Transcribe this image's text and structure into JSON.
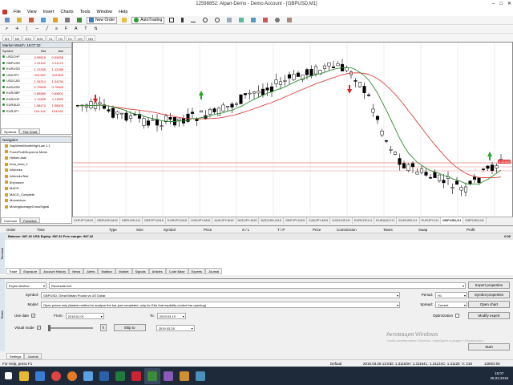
{
  "window": {
    "title": "12598852: Alpari-Demo - Demo Account - [GBPUSD,M1]",
    "minimize": "–",
    "maximize": "□",
    "close": "✕"
  },
  "menu": [
    "File",
    "View",
    "Insert",
    "Charts",
    "Tools",
    "Window",
    "Help"
  ],
  "toolbar": {
    "new_order": "New Order",
    "autotrading": "AutoTrading"
  },
  "timeframes": [
    "M1",
    "M5",
    "M15",
    "M30",
    "H1",
    "H4",
    "D1",
    "W1",
    "MN"
  ],
  "market_watch": {
    "title": "Market Watch: 15:07:32",
    "columns": [
      "Symbol",
      "Bid",
      "Ask"
    ],
    "rows": [
      {
        "symbol": "USDCHF",
        "bid": "0.99615",
        "ask": "0.99636"
      },
      {
        "symbol": "GBPUSD",
        "bid": "1.31152",
        "ask": "1.31172"
      },
      {
        "symbol": "EURUSD",
        "bid": "1.12265",
        "ask": "1.12285"
      },
      {
        "symbol": "USDJPY",
        "bid": "110.587",
        "ask": "110.600"
      },
      {
        "symbol": "USDCAD",
        "bid": "1.34214",
        "ask": "1.34234"
      },
      {
        "symbol": "AUDUSD",
        "bid": "0.70625",
        "ask": "0.70640"
      },
      {
        "symbol": "EURGBP",
        "bid": "0.85580",
        "ask": "0.85601"
      },
      {
        "symbol": "EURCHF",
        "bid": "1.11835",
        "ask": "1.11832"
      },
      {
        "symbol": "EURAUD",
        "bid": "1.58472",
        "ask": "1.58505"
      },
      {
        "symbol": "EURJPY",
        "bid": "124.141",
        "ask": "124.161"
      }
    ],
    "tabs": [
      "Symbols",
      "Tick Chart"
    ]
  },
  "navigator": {
    "title": "Navigator",
    "items": [
      "DayWeekMonthHighLow 1.1",
      "ForexProfitSupreme Meter",
      "Heiken Ashi",
      "hma_histo_1",
      "Ichimoku",
      "IchimokuTest",
      "iExposure",
      "MACD",
      "MACD_Complete",
      "Momentum",
      "MovingAverageCrossSignal"
    ],
    "tabs": [
      "Common",
      "Favorites"
    ]
  },
  "chart_tabs": [
    "CHFJPY,M15",
    "GBPUSD,M15",
    "GBPUSD,H4",
    "GBPJPY,M15",
    "EURJPY,M15",
    "USDJPY,M15",
    "AUDJPY,M15",
    "NZDJPY,M15",
    "NZDUSD,M15",
    "GBPJPY,M15",
    "CADJPY,M15",
    "USDCHF,H1",
    "EURCHF,H1",
    "EURAUD,H1",
    "EURUSD,H1",
    "EURJPY,H1",
    "GBPUSD,H1",
    "GBPUSD,M1"
  ],
  "chart": {
    "price_label": "1.31152",
    "accent_candle_up": "#000000",
    "ma_fast_color": "#2e8b2e",
    "ma_slow_color": "#e04040"
  },
  "terminal": {
    "columns": [
      "Order",
      "Time",
      "Type",
      "Size",
      "Symbol",
      "Price",
      "S / L",
      "T / P",
      "Price",
      "Commission",
      "Taxes",
      "Swap",
      "Profit"
    ],
    "balance": "Balance: 987.32 USD  Equity: 987.32  Free margin: 987.32",
    "balance_profit": "0.00",
    "tabs": [
      "Trade",
      "Exposure",
      "Account History",
      "News",
      "Alerts",
      "Mailbox",
      "Market",
      "Signals",
      "Articles",
      "Code Base",
      "Experts",
      "Journal"
    ],
    "side_label": "Terminal"
  },
  "tester": {
    "side_label": "Tester",
    "type": "Expert Advisor",
    "ea": "Reversals.ex4",
    "symbol_label": "Symbol:",
    "symbol": "GBPUSD, Great Britain Pound vs US Dollar",
    "model_label": "Model:",
    "model": "Open prices only (fastest method to analyze the bar just completed, only for EAs that explicitly control bar opening)",
    "use_date": "Use date",
    "from_label": "From:",
    "from": "2018.01.01",
    "to_label": "To:",
    "to": "2019.03.19",
    "visual_mode": "Visual mode",
    "skip_to": "Skip to",
    "skip_date": "2019.03.28",
    "period_label": "Period:",
    "period": "H1",
    "spread_label": "Spread:",
    "spread": "Current",
    "optimization": "Optimization",
    "buttons": {
      "expert_properties": "Expert properties",
      "symbol_properties": "Symbol properties",
      "open_chart": "Open chart",
      "modify_expert": "Modify expert",
      "start": "Start"
    },
    "tabs": [
      "Settings",
      "Journal"
    ],
    "watermark_title": "Активация Windows",
    "watermark_sub": "Чтобы активировать Windows, перейдите в раздел «Параметры»."
  },
  "status": {
    "help": "For Help, press F1",
    "profile": "Default",
    "datetime": "2019.03.28 13:04",
    "open": "O: 1.31163",
    "high": "H: 1.31164",
    "low": "L: 1.31124",
    "close": "C: 1.31125",
    "volume": "V: 218",
    "traffic": "1280/3 kb"
  },
  "taskbar": {
    "time": "15:07",
    "date": "28.03.2019"
  }
}
